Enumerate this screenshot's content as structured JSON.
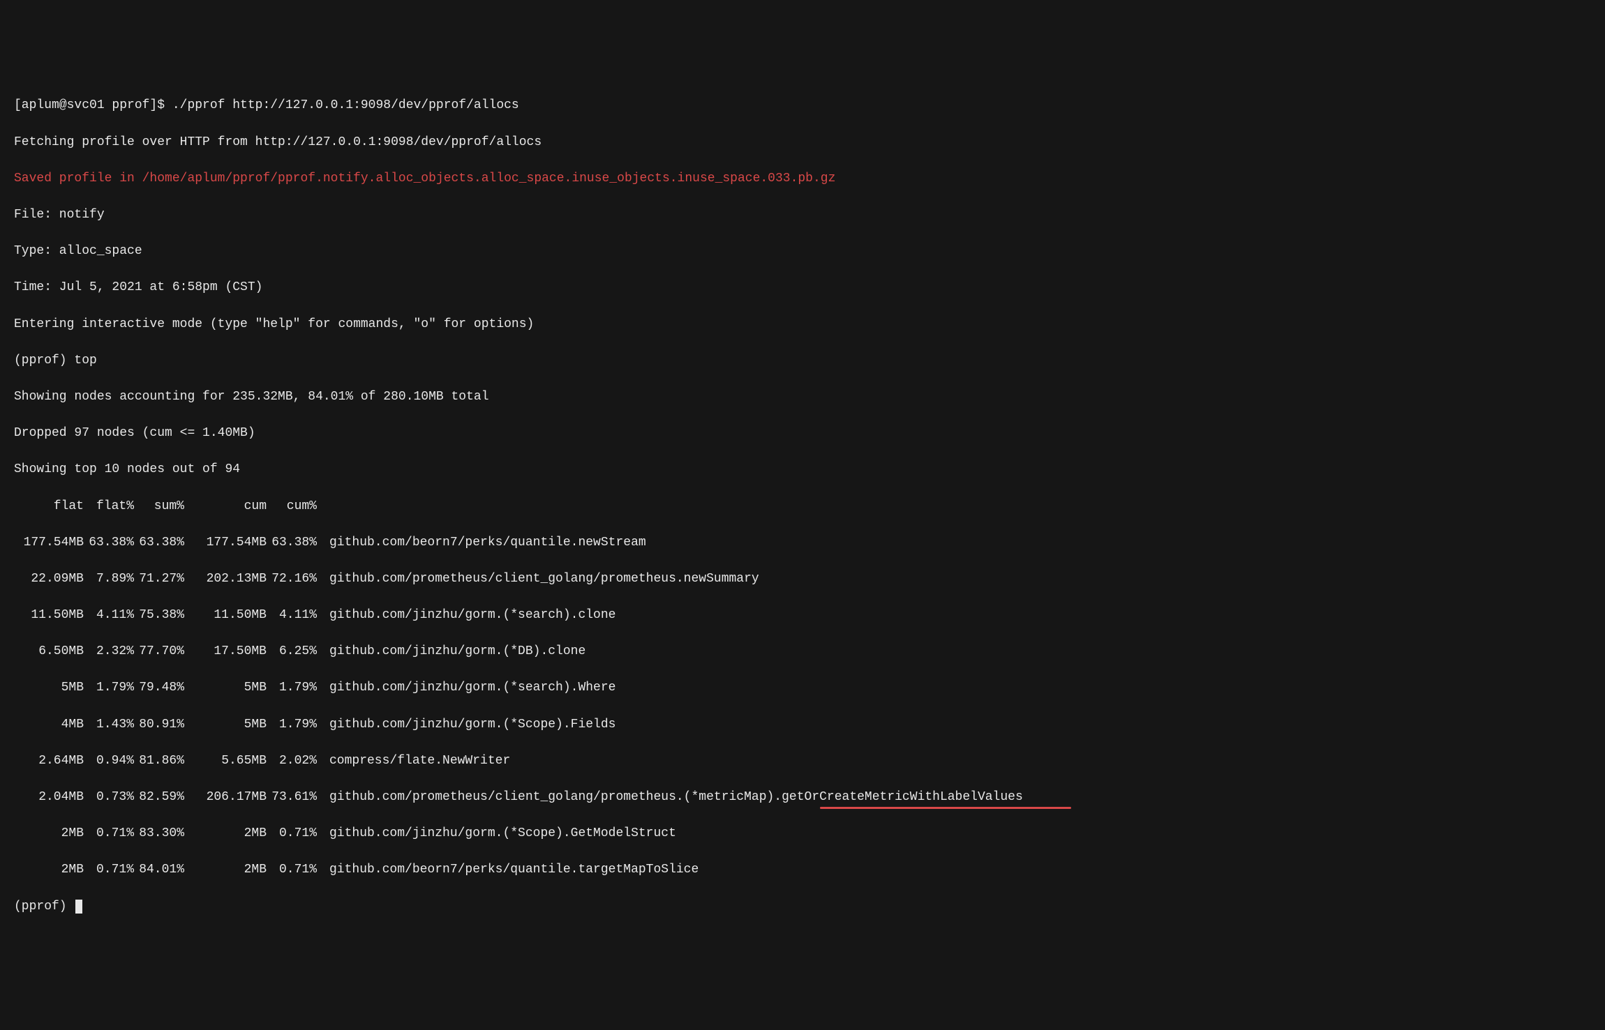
{
  "prompt1": "[aplum@svc01 pprof]$ ./pprof http://127.0.0.1:9098/dev/pprof/allocs",
  "fetching": "Fetching profile over HTTP from http://127.0.0.1:9098/dev/pprof/allocs",
  "saved": "Saved profile in /home/aplum/pprof/pprof.notify.alloc_objects.alloc_space.inuse_objects.inuse_space.033.pb.gz",
  "file_line": "File: notify",
  "type_line": "Type: alloc_space",
  "time_line": "Time: Jul 5, 2021 at 6:58pm (CST)",
  "entering": "Entering interactive mode (type \"help\" for commands, \"o\" for options)",
  "prompt_top": "(pprof) top",
  "showing_nodes": "Showing nodes accounting for 235.32MB, 84.01% of 280.10MB total",
  "dropped": "Dropped 97 nodes (cum <= 1.40MB)",
  "showing_top": "Showing top 10 nodes out of 94",
  "headers": {
    "flat": "flat",
    "flatp": "flat%",
    "sump": "sum%",
    "cum": "cum",
    "cump": "cum%"
  },
  "rows": [
    {
      "flat": "177.54MB",
      "flatp": "63.38%",
      "sump": "63.38%",
      "cum": "177.54MB",
      "cump": "63.38%",
      "fn": "github.com/beorn7/perks/quantile.newStream"
    },
    {
      "flat": "22.09MB",
      "flatp": "7.89%",
      "sump": "71.27%",
      "cum": "202.13MB",
      "cump": "72.16%",
      "fn": "github.com/prometheus/client_golang/prometheus.newSummary"
    },
    {
      "flat": "11.50MB",
      "flatp": "4.11%",
      "sump": "75.38%",
      "cum": "11.50MB",
      "cump": "4.11%",
      "fn": "github.com/jinzhu/gorm.(*search).clone"
    },
    {
      "flat": "6.50MB",
      "flatp": "2.32%",
      "sump": "77.70%",
      "cum": "17.50MB",
      "cump": "6.25%",
      "fn": "github.com/jinzhu/gorm.(*DB).clone"
    },
    {
      "flat": "5MB",
      "flatp": "1.79%",
      "sump": "79.48%",
      "cum": "5MB",
      "cump": "1.79%",
      "fn": "github.com/jinzhu/gorm.(*search).Where"
    },
    {
      "flat": "4MB",
      "flatp": "1.43%",
      "sump": "80.91%",
      "cum": "5MB",
      "cump": "1.79%",
      "fn": "github.com/jinzhu/gorm.(*Scope).Fields"
    },
    {
      "flat": "2.64MB",
      "flatp": "0.94%",
      "sump": "81.86%",
      "cum": "5.65MB",
      "cump": "2.02%",
      "fn": "compress/flate.NewWriter"
    },
    {
      "flat": "2.04MB",
      "flatp": "0.73%",
      "sump": "82.59%",
      "cum": "206.17MB",
      "cump": "73.61%",
      "fn": "github.com/prometheus/client_golang/prometheus.(*metricMap).getOrCreateMetricWithLabelValues"
    },
    {
      "flat": "2MB",
      "flatp": "0.71%",
      "sump": "83.30%",
      "cum": "2MB",
      "cump": "0.71%",
      "fn": "github.com/jinzhu/gorm.(*Scope).GetModelStruct"
    },
    {
      "flat": "2MB",
      "flatp": "0.71%",
      "sump": "84.01%",
      "cum": "2MB",
      "cump": "0.71%",
      "fn": "github.com/beorn7/perks/quantile.targetMapToSlice"
    }
  ],
  "prompt_end": "(pprof) "
}
